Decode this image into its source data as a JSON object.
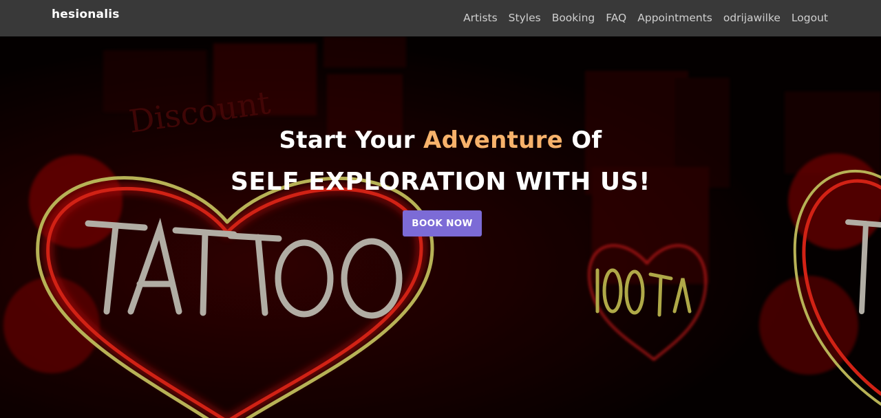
{
  "navbar": {
    "brand": "hesionalis",
    "links": [
      "Artists",
      "Styles",
      "Booking",
      "FAQ",
      "Appointments",
      "odrijawilke",
      "Logout"
    ]
  },
  "hero": {
    "line1_part1": "Start Your ",
    "line1_accent": "Adventure",
    "line1_part2": " Of",
    "line2": "SELF EXPLORATION WITH US!",
    "button_label": "BOOK NOW",
    "background_sign_text": "TATTOO"
  },
  "colors": {
    "navbar_bg": "#393939",
    "accent_text": "#f7b26b",
    "button_bg": "#7c6bd6",
    "neon_red": "#e01010",
    "neon_yellow": "#e8e070"
  }
}
